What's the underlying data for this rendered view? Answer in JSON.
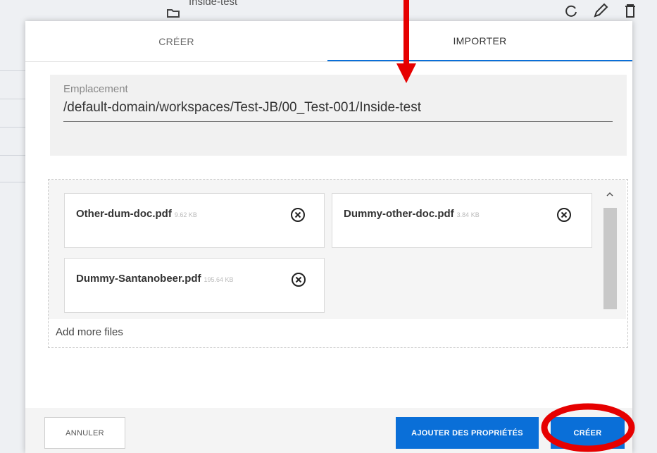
{
  "background": {
    "folder_title": "Inside-test"
  },
  "tabs": {
    "create": "CRÉER",
    "import": "IMPORTER"
  },
  "location": {
    "label": "Emplacement",
    "value": "/default-domain/workspaces/Test-JB/00_Test-001/Inside-test"
  },
  "files": [
    {
      "name": "Other-dum-doc.pdf",
      "size": "9.62 KB"
    },
    {
      "name": "Dummy-other-doc.pdf",
      "size": "3.84 KB"
    },
    {
      "name": "Dummy-Santanobeer.pdf",
      "size": "195.64 KB"
    }
  ],
  "dropzone": {
    "add_more": "Add more files"
  },
  "footer": {
    "cancel": "ANNULER",
    "add_properties": "AJOUTER DES PROPRIÉTÉS",
    "create": "CRÉER"
  },
  "colors": {
    "accent": "#0a6fd8",
    "annotation": "#e60000"
  },
  "icons": {
    "remove": "close-circle-icon",
    "scroll_up": "chevron-up-icon",
    "bg_folder": "folder-icon",
    "bg_refresh": "refresh-icon",
    "bg_edit": "pencil-icon",
    "bg_delete": "trash-icon"
  }
}
